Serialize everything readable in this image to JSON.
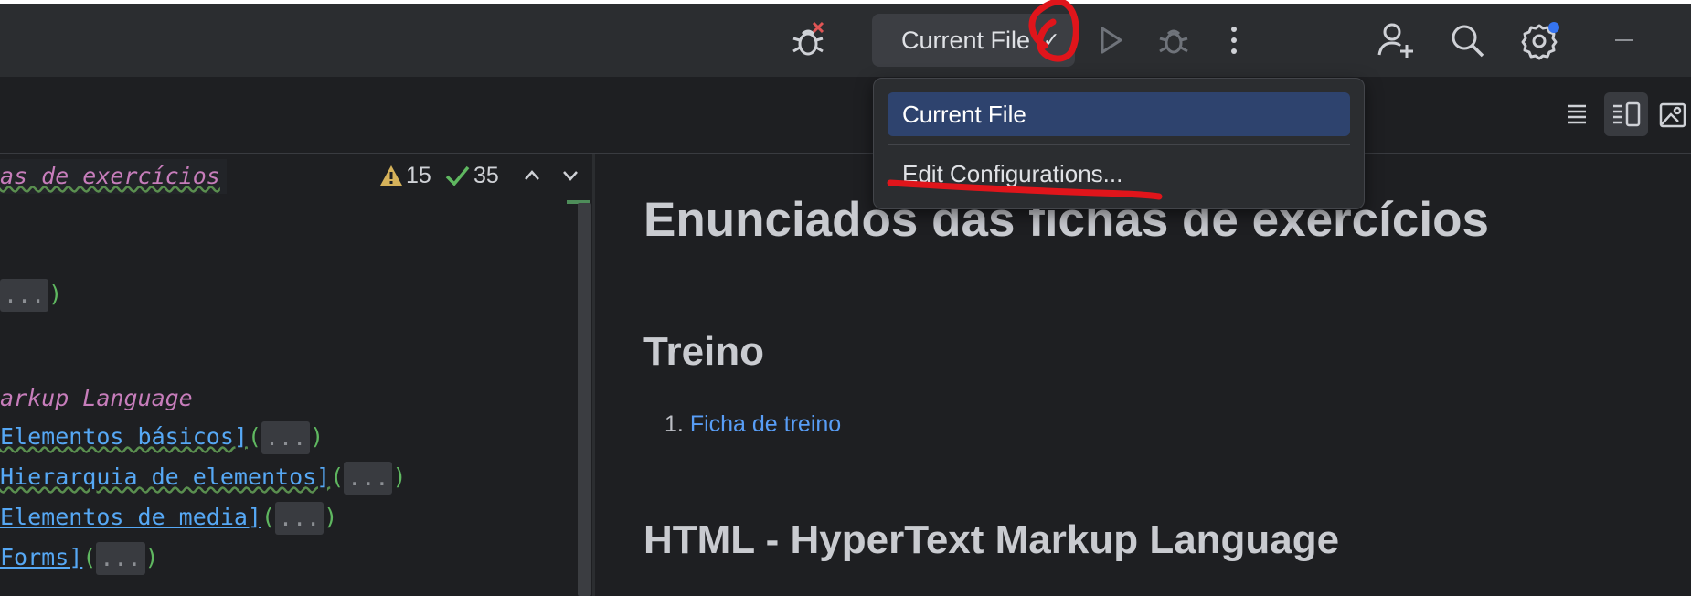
{
  "run_config": {
    "selected": "Current File",
    "chevron": "✓"
  },
  "dropdown": {
    "items": [
      "Current File",
      "Edit Configurations..."
    ]
  },
  "inspections": {
    "warnings": "15",
    "ok": "35"
  },
  "code": {
    "breadcrumb": "as de exercícios",
    "lines": [
      {
        "type": "fold_only"
      },
      {
        "type": "heading",
        "text": "arkup Language"
      },
      {
        "type": "link",
        "text": "Elementos básicos]"
      },
      {
        "type": "link",
        "text": "Hierarquia de elementos]"
      },
      {
        "type": "link",
        "text": "Elementos de media]"
      },
      {
        "type": "link",
        "text": "Forms]"
      }
    ],
    "fold": "...",
    "paren_open": "(",
    "paren_close": ")"
  },
  "preview": {
    "h1": "Enunciados das fichas de exercícios",
    "h2_treino": "Treino",
    "li_number": "1.",
    "li_link": "Ficha de treino",
    "h2_html": "HTML - HyperText Markup Language"
  },
  "colors": {
    "accent_selection": "#2e436e",
    "link": "#589df6",
    "annotation": "#e0151b",
    "notification_dot": "#3574f0"
  },
  "icons": [
    "debug-error-icon",
    "run-icon",
    "debug-icon",
    "more-vertical-icon",
    "add-user-icon",
    "search-icon",
    "settings-icon",
    "minimize-icon",
    "list-view-icon",
    "split-view-icon",
    "preview-image-icon"
  ]
}
